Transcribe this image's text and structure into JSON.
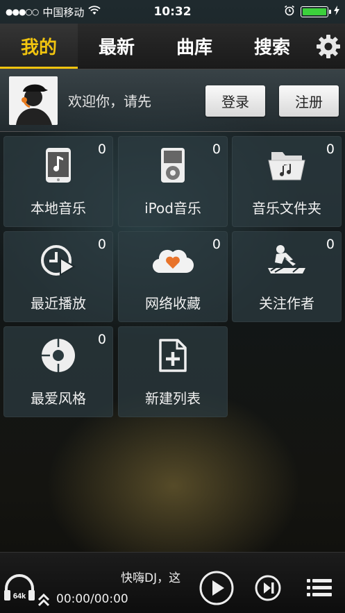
{
  "status_bar": {
    "signal_dots": "●●●○○",
    "carrier": "中国移动",
    "time": "10:32",
    "battery_color": "#3cd13c",
    "icons": [
      "signal-icon",
      "wifi-icon",
      "alarm-icon",
      "battery-icon",
      "charging-icon"
    ]
  },
  "tabs": [
    {
      "label": "我的",
      "active": true
    },
    {
      "label": "最新",
      "active": false
    },
    {
      "label": "曲库",
      "active": false
    },
    {
      "label": "搜索",
      "active": false
    }
  ],
  "settings_icon": "gear-icon",
  "user": {
    "welcome_text": "欢迎你，请先",
    "login_label": "登录",
    "register_label": "注册",
    "avatar_icon": "dj-avatar"
  },
  "tiles": [
    {
      "label": "本地音乐",
      "count": "0",
      "icon": "phone-music-icon"
    },
    {
      "label": "iPod音乐",
      "count": "0",
      "icon": "ipod-icon"
    },
    {
      "label": "音乐文件夹",
      "count": "0",
      "icon": "music-folder-icon"
    },
    {
      "label": "最近播放",
      "count": "0",
      "icon": "recent-play-icon"
    },
    {
      "label": "网络收藏",
      "count": "0",
      "icon": "cloud-heart-icon"
    },
    {
      "label": "关注作者",
      "count": "0",
      "icon": "dj-artist-icon"
    },
    {
      "label": "最爱风格",
      "count": "0",
      "icon": "vinyl-icon"
    },
    {
      "label": "新建列表",
      "count": "",
      "icon": "new-file-icon"
    }
  ],
  "player": {
    "bitrate": "64k",
    "track_title": "快嗨DJ，这",
    "time": "00:00/00:00",
    "icons": [
      "headphone-icon",
      "expand-up-icon",
      "play-icon",
      "next-icon",
      "playlist-icon"
    ]
  },
  "colors": {
    "accent": "#f1c40f",
    "heart": "#e8732a"
  }
}
